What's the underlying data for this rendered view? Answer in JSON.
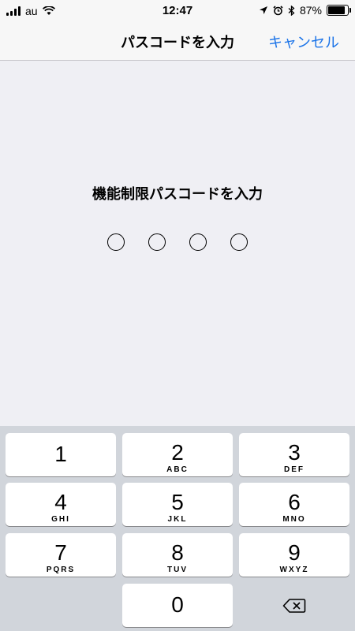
{
  "status_bar": {
    "carrier": "au",
    "time": "12:47",
    "battery": "87%",
    "battery_level": 0.87,
    "icons": [
      "signal-icon",
      "wifi-icon",
      "location-icon",
      "alarm-icon",
      "bluetooth-icon",
      "battery-icon"
    ]
  },
  "navbar": {
    "title": "パスコードを入力",
    "cancel_label": "キャンセル",
    "accent_color": "#1a73e8"
  },
  "prompt": "機能制限パスコードを入力",
  "passcode": {
    "length": 4,
    "entered": 0
  },
  "keypad": {
    "keys": [
      {
        "num": "1",
        "letters": ""
      },
      {
        "num": "2",
        "letters": "ABC"
      },
      {
        "num": "3",
        "letters": "DEF"
      },
      {
        "num": "4",
        "letters": "GHI"
      },
      {
        "num": "5",
        "letters": "JKL"
      },
      {
        "num": "6",
        "letters": "MNO"
      },
      {
        "num": "7",
        "letters": "PQRS"
      },
      {
        "num": "8",
        "letters": "TUV"
      },
      {
        "num": "9",
        "letters": "WXYZ"
      },
      {
        "num": "0",
        "letters": ""
      }
    ],
    "delete_icon": "backspace-icon"
  }
}
